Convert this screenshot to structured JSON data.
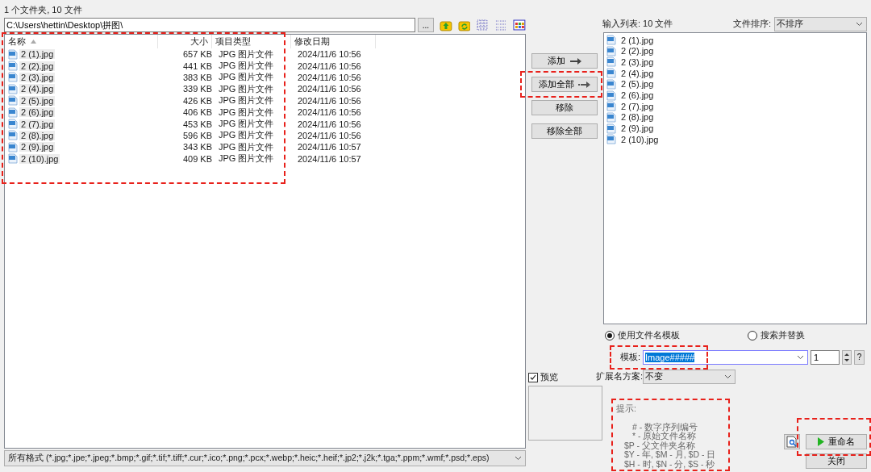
{
  "status": "1 个文件夹, 10 文件",
  "path": "C:\\Users\\hettin\\Desktop\\拼图\\",
  "browse_button": "...",
  "table": {
    "columns": [
      {
        "label": "名称",
        "sorted": true
      },
      {
        "label": "大小",
        "sorted": false
      },
      {
        "label": "项目类型",
        "sorted": false
      },
      {
        "label": "修改日期",
        "sorted": false
      }
    ],
    "rows": [
      {
        "name": "2 (1).jpg",
        "size": "657 KB",
        "type": "JPG 图片文件",
        "date": "2024/11/6 10:56"
      },
      {
        "name": "2 (2).jpg",
        "size": "441 KB",
        "type": "JPG 图片文件",
        "date": "2024/11/6 10:56"
      },
      {
        "name": "2 (3).jpg",
        "size": "383 KB",
        "type": "JPG 图片文件",
        "date": "2024/11/6 10:56"
      },
      {
        "name": "2 (4).jpg",
        "size": "339 KB",
        "type": "JPG 图片文件",
        "date": "2024/11/6 10:56"
      },
      {
        "name": "2 (5).jpg",
        "size": "426 KB",
        "type": "JPG 图片文件",
        "date": "2024/11/6 10:56"
      },
      {
        "name": "2 (6).jpg",
        "size": "406 KB",
        "type": "JPG 图片文件",
        "date": "2024/11/6 10:56"
      },
      {
        "name": "2 (7).jpg",
        "size": "453 KB",
        "type": "JPG 图片文件",
        "date": "2024/11/6 10:56"
      },
      {
        "name": "2 (8).jpg",
        "size": "596 KB",
        "type": "JPG 图片文件",
        "date": "2024/11/6 10:56"
      },
      {
        "name": "2 (9).jpg",
        "size": "343 KB",
        "type": "JPG 图片文件",
        "date": "2024/11/6 10:57"
      },
      {
        "name": "2 (10).jpg",
        "size": "409 KB",
        "type": "JPG 图片文件",
        "date": "2024/11/6 10:57"
      }
    ]
  },
  "filter": "所有格式 (*.jpg;*.jpe;*.jpeg;*.bmp;*.gif;*.tif;*.tiff;*.cur;*.ico;*.png;*.pcx;*.webp;*.heic;*.heif;*.jp2;*.j2k;*.tga;*.ppm;*.wmf;*.psd;*.eps)",
  "transfer_buttons": [
    {
      "label": "添加",
      "kind": "arrow"
    },
    {
      "label": "添加全部",
      "kind": "double-arrow"
    },
    {
      "label": "移除",
      "kind": "plain"
    },
    {
      "label": "移除全部",
      "kind": "plain"
    }
  ],
  "input_list": {
    "title": "输入列表: 10 文件",
    "sort_label": "文件排序:",
    "sort_value": "不排序",
    "items": [
      "2 (1).jpg",
      "2 (2).jpg",
      "2 (3).jpg",
      "2 (4).jpg",
      "2 (5).jpg",
      "2 (6).jpg",
      "2 (7).jpg",
      "2 (8).jpg",
      "2 (9).jpg",
      "2 (10).jpg"
    ]
  },
  "modes": [
    {
      "label": "使用文件名模板",
      "selected": true
    },
    {
      "label": "搜索并替换",
      "selected": false
    }
  ],
  "template": {
    "label": "模板:",
    "value": "Image#####",
    "value_selected": true,
    "start": "1",
    "help": "?"
  },
  "extension": {
    "label": "扩展名方案:",
    "value": "不变"
  },
  "preview": {
    "label": "预览",
    "checked": true
  },
  "hints": {
    "title": "提示:",
    "lines": [
      "#  - 数字序列编号",
      "*  - 原始文件名称",
      "$P - 父文件夹名称",
      "$Y - 年, $M - 月, $D - 日",
      "$H - 时, $N - 分, $S - 秒"
    ]
  },
  "rename_button": "重命名",
  "close_button": "关闭"
}
